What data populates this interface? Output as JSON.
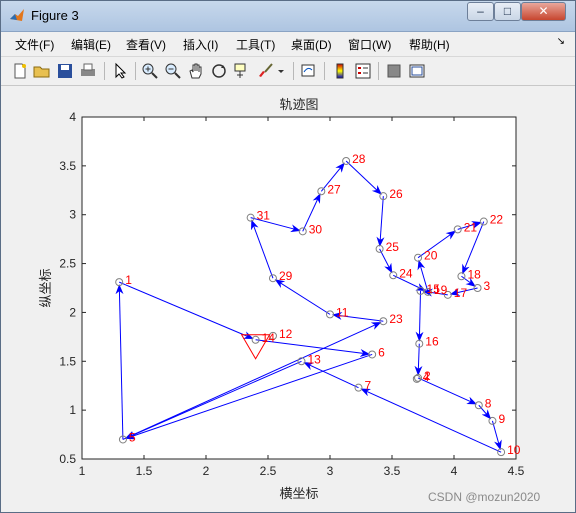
{
  "window": {
    "title": "Figure 3",
    "buttons": {
      "minimize": "–",
      "maximize": "□",
      "close": "✕"
    }
  },
  "menu": {
    "items": [
      "文件(F)",
      "编辑(E)",
      "查看(V)",
      "插入(I)",
      "工具(T)",
      "桌面(D)",
      "窗口(W)",
      "帮助(H)"
    ],
    "dock_arrow": "↘"
  },
  "toolbar": {
    "icons": [
      "new-figure-icon",
      "open-icon",
      "save-icon",
      "print-icon",
      "pointer-icon",
      "zoom-in-icon",
      "zoom-out-icon",
      "pan-hand-icon",
      "rotate-3d-icon",
      "data-cursor-icon",
      "brush-icon",
      "dropdown-arrow-icon",
      "link-plot-icon",
      "colorbar-icon",
      "legend-icon",
      "hide-plot-tools-icon",
      "show-plot-tools-icon"
    ]
  },
  "colors": {
    "route": "#0000ff",
    "label": "#ff0000",
    "start_marker": "#ff0000",
    "point": "#808080"
  },
  "chart_data": {
    "type": "line",
    "title": "轨迹图",
    "xlabel": "横坐标",
    "ylabel": "纵坐标",
    "xlim": [
      1,
      4.5
    ],
    "ylim": [
      0.5,
      4
    ],
    "xticks": [
      "1",
      "1.5",
      "2",
      "2.5",
      "3",
      "3.5",
      "4",
      "4.5"
    ],
    "yticks": [
      "0.5",
      "1",
      "1.5",
      "2",
      "2.5",
      "3",
      "3.5",
      "4"
    ],
    "grid": false,
    "points": [
      {
        "id": "1",
        "x": 1.3,
        "y": 2.31
      },
      {
        "id": "2",
        "x": 3.71,
        "y": 1.33
      },
      {
        "id": "3",
        "x": 4.19,
        "y": 2.25
      },
      {
        "id": "4",
        "x": 3.7,
        "y": 1.32
      },
      {
        "id": "5",
        "x": 1.33,
        "y": 0.7
      },
      {
        "id": "6",
        "x": 3.34,
        "y": 1.57
      },
      {
        "id": "7",
        "x": 3.23,
        "y": 1.23
      },
      {
        "id": "8",
        "x": 4.2,
        "y": 1.05
      },
      {
        "id": "9",
        "x": 4.31,
        "y": 0.89
      },
      {
        "id": "10",
        "x": 4.38,
        "y": 0.57
      },
      {
        "id": "11",
        "x": 3.0,
        "y": 1.98
      },
      {
        "id": "12",
        "x": 2.54,
        "y": 1.76
      },
      {
        "id": "13",
        "x": 2.77,
        "y": 1.5
      },
      {
        "id": "14",
        "x": 2.4,
        "y": 1.72
      },
      {
        "id": "15",
        "x": 3.73,
        "y": 2.22
      },
      {
        "id": "16",
        "x": 3.72,
        "y": 1.68
      },
      {
        "id": "17",
        "x": 3.95,
        "y": 2.18
      },
      {
        "id": "18",
        "x": 4.06,
        "y": 2.37
      },
      {
        "id": "19",
        "x": 3.79,
        "y": 2.21
      },
      {
        "id": "20",
        "x": 3.71,
        "y": 2.56
      },
      {
        "id": "21",
        "x": 4.03,
        "y": 2.85
      },
      {
        "id": "22",
        "x": 4.24,
        "y": 2.93
      },
      {
        "id": "23",
        "x": 3.43,
        "y": 1.91
      },
      {
        "id": "24",
        "x": 3.51,
        "y": 2.38
      },
      {
        "id": "25",
        "x": 3.4,
        "y": 2.65
      },
      {
        "id": "26",
        "x": 3.43,
        "y": 3.19
      },
      {
        "id": "27",
        "x": 2.93,
        "y": 3.24
      },
      {
        "id": "28",
        "x": 3.13,
        "y": 3.55
      },
      {
        "id": "29",
        "x": 2.54,
        "y": 2.35
      },
      {
        "id": "30",
        "x": 2.78,
        "y": 2.83
      },
      {
        "id": "31",
        "x": 2.36,
        "y": 2.97
      }
    ],
    "route": [
      "14",
      "6",
      "5",
      "23",
      "11",
      "29",
      "31",
      "30",
      "27",
      "28",
      "26",
      "25",
      "24",
      "19",
      "20",
      "21",
      "22",
      "18",
      "3",
      "17",
      "15",
      "16",
      "2",
      "8",
      "9",
      "10",
      "7",
      "13",
      "5",
      "1",
      "14"
    ],
    "start": "14"
  },
  "watermark": "CSDN @mozun2020"
}
